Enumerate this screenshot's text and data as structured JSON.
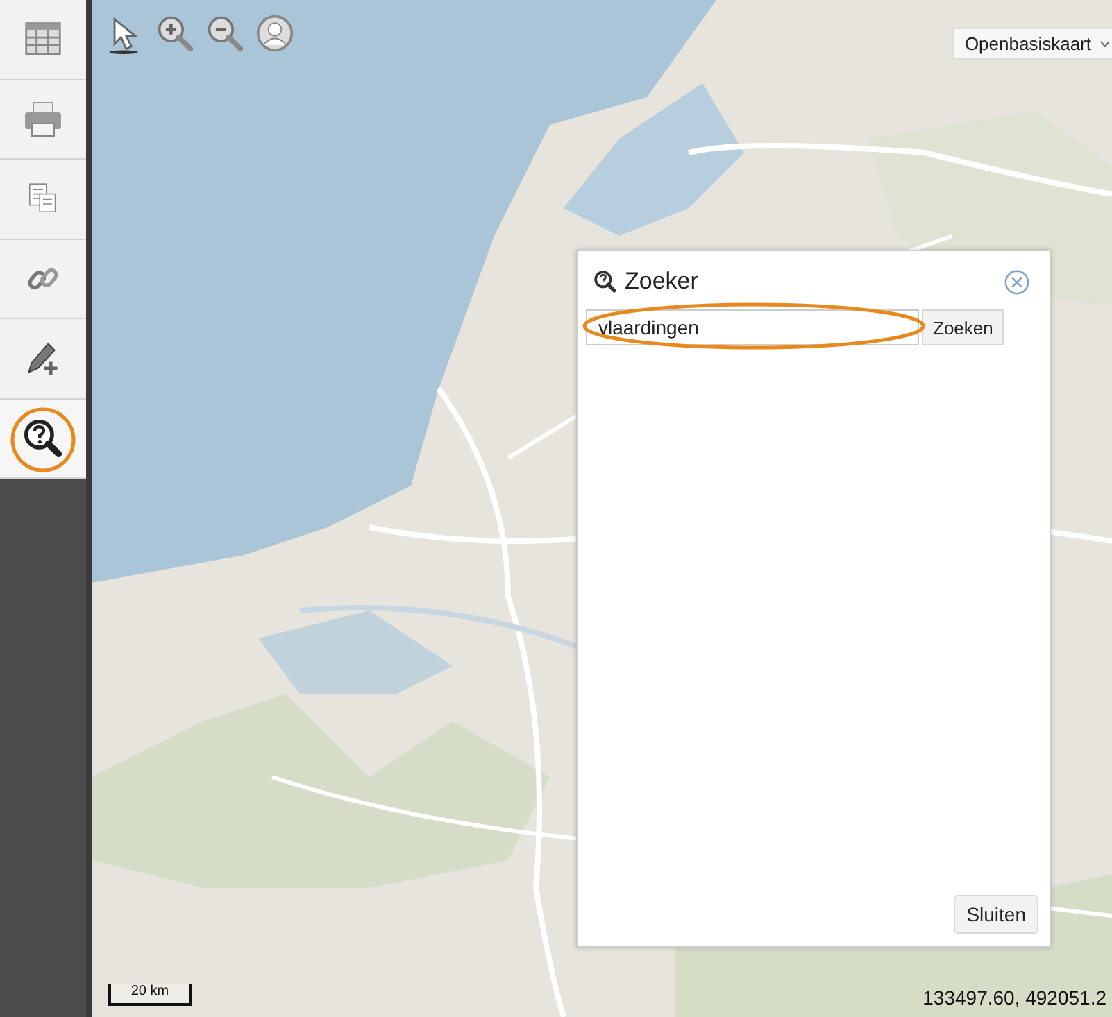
{
  "map": {
    "layer_select": {
      "value": "Openbasiskaart"
    },
    "scale": "20 km",
    "coordinates": "133497.60, 492051.2"
  },
  "dialog": {
    "title": "Zoeker",
    "search": {
      "value": "vlaardingen"
    },
    "search_button": "Zoeken",
    "close_button": "Sluiten"
  }
}
